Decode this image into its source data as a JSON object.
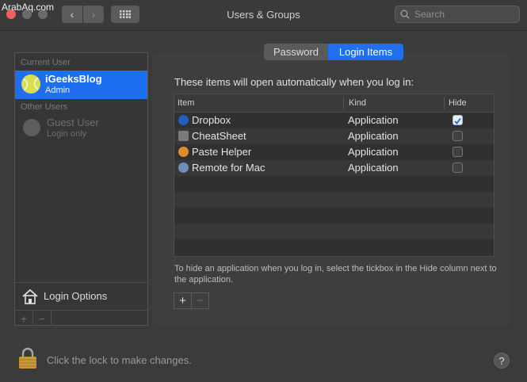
{
  "watermark": "ArabAq.com",
  "window": {
    "title": "Users & Groups"
  },
  "search": {
    "placeholder": "Search"
  },
  "sidebar": {
    "current_user_header": "Current User",
    "current_user": {
      "name": "iGeeksBlog",
      "role": "Admin"
    },
    "other_users_header": "Other Users",
    "guest": {
      "name": "Guest User",
      "subtitle": "Login only"
    },
    "login_options_label": "Login Options",
    "add_label": "+",
    "remove_label": "−"
  },
  "tabs": [
    {
      "label": "Password",
      "selected": false
    },
    {
      "label": "Login Items",
      "selected": true
    }
  ],
  "login_items": {
    "intro": "These items will open automatically when you log in:",
    "columns": [
      "Item",
      "Kind",
      "Hide"
    ],
    "rows": [
      {
        "item": "Dropbox",
        "kind": "Application",
        "hide": true,
        "icon": "dropbox-icon",
        "color": "#1f5fbf"
      },
      {
        "item": "CheatSheet",
        "kind": "Application",
        "hide": false,
        "icon": "cheatsheet-icon",
        "color": "#7a7a7a"
      },
      {
        "item": "Paste Helper",
        "kind": "Application",
        "hide": false,
        "icon": "paste-helper-icon",
        "color": "#e08a2b"
      },
      {
        "item": "Remote for Mac",
        "kind": "Application",
        "hide": false,
        "icon": "remote-for-mac-icon",
        "color": "#6a8fb8"
      }
    ],
    "note": "To hide an application when you log in, select the tickbox in the Hide column next to the application.",
    "add_label": "+",
    "remove_label": "−"
  },
  "footer": {
    "lock_text": "Click the lock to make changes.",
    "help_label": "?"
  },
  "colors": {
    "accent": "#1f6ff0",
    "close": "#ec5f5a"
  }
}
